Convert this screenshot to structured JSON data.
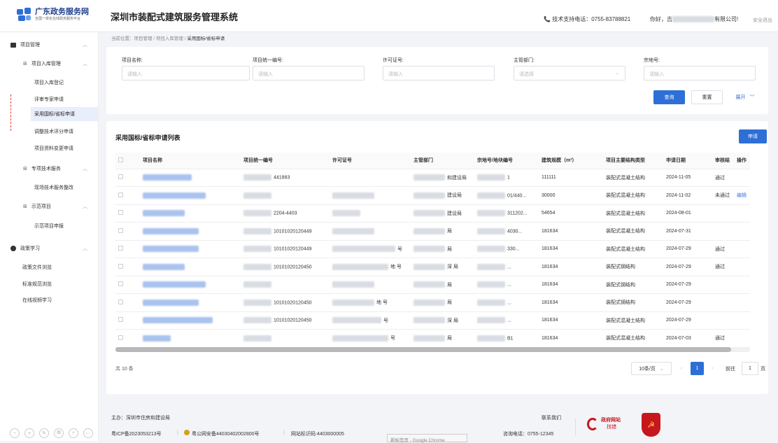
{
  "header": {
    "logo_title": "广东政务服务网",
    "logo_subtitle": "全国一体化在线政务服务平台",
    "system_title": "深圳市装配式建筑服务管理系统",
    "support_phone": "技术支持电话：0755-83788821",
    "greeting_prefix": "你好，吉",
    "greeting_suffix": "有限公司!",
    "logout": "安全退出"
  },
  "sidebar": {
    "project_mgmt": "项目管理",
    "project_storage": "项目入库管理",
    "project_register": "项目入库登记",
    "expert_apply": "评审专家申请",
    "standard_apply": "采用国标/省标申请",
    "score_adjust": "调整技术评分申请",
    "data_change": "项目资料变更申请",
    "tech_service": "专项技术服务",
    "site_service": "现场技术服务整改",
    "demo_project": "示范项目",
    "demo_apply": "示范项目申报",
    "policy": "政策学习",
    "policy_browse": "政策文件浏览",
    "norm_browse": "标准规范浏览",
    "video": "在线视频学习"
  },
  "breadcrumb": {
    "prefix": "当前位置：",
    "path": "项目管理 / 项目入库管理 / ",
    "current": "采用国标/省标申请"
  },
  "filters": {
    "name_label": "项目名称:",
    "name_placeholder": "请输入",
    "code_label": "项目统一编号:",
    "code_placeholder": "请输入",
    "permit_label": "许可证号:",
    "permit_placeholder": "请输入",
    "dept_label": "主管部门:",
    "dept_placeholder": "请选择",
    "land_label": "宗地号:",
    "land_placeholder": "请输入",
    "search_button": "查询",
    "reset_button": "重置",
    "expand_button": "展开"
  },
  "list": {
    "title": "采用国标/省标申请列表",
    "apply_button": "申请",
    "columns": [
      "项目名称",
      "项目统一编号",
      "许可证号",
      "主管部门",
      "宗地号/地块编号",
      "建筑规模（m²）",
      "项目主要结构类型",
      "申请日期",
      "审核结",
      "操作"
    ],
    "rows": [
      {
        "code": "441883",
        "permit": "",
        "dept": "和建设局",
        "land": "1",
        "scale": "111111",
        "type": "装配式混凝土结构",
        "date": "2024-11-05",
        "status": "通过",
        "op": ""
      },
      {
        "code": "",
        "permit": "",
        "dept": "建设局",
        "land": "01/440...",
        "scale": "30000",
        "type": "装配式混凝土结构",
        "date": "2024-11-02",
        "status": "未通过",
        "op": "编辑"
      },
      {
        "code": "2204-4403",
        "permit": "",
        "dept": "建设局",
        "land": "311202...",
        "scale": "54654",
        "type": "装配式混凝土结构",
        "date": "2024-08-01",
        "status": "",
        "op": ""
      },
      {
        "code": "10101020120449",
        "permit": "",
        "dept": "局",
        "land": "4030...",
        "scale": "181634",
        "type": "装配式混凝土结构",
        "date": "2024-07-31",
        "status": "",
        "op": ""
      },
      {
        "code": "10101020120449",
        "permit": "号",
        "dept": "局",
        "land": "330...",
        "scale": "181634",
        "type": "装配式混凝土结构",
        "date": "2024-07-29",
        "status": "通过",
        "op": ""
      },
      {
        "code": "10101020120450",
        "permit": "地 号",
        "dept": "深 局",
        "land": "...",
        "scale": "181634",
        "type": "装配式钢结构",
        "date": "2024-07-29",
        "status": "通过",
        "op": ""
      },
      {
        "code": "",
        "permit": "",
        "dept": "局",
        "land": "...",
        "scale": "181634",
        "type": "装配式钢结构",
        "date": "2024-07-29",
        "status": "",
        "op": ""
      },
      {
        "code": "10101020120450",
        "permit": "地 号",
        "dept": "局",
        "land": "...",
        "scale": "181634",
        "type": "装配式钢结构",
        "date": "2024-07-29",
        "status": "",
        "op": ""
      },
      {
        "code": "10101020120450",
        "permit": "号",
        "dept": "深 局",
        "land": "...",
        "scale": "181634",
        "type": "装配式混凝土结构",
        "date": "2024-07-29",
        "status": "",
        "op": ""
      },
      {
        "code": "",
        "permit": "号",
        "dept": "局",
        "land": "B1",
        "scale": "181634",
        "type": "装配式混凝土结构",
        "date": "2024-07-03",
        "status": "通过",
        "op": ""
      }
    ]
  },
  "pagination": {
    "total": "共 10 条",
    "page_size": "10条/页",
    "current_page": "1",
    "goto_label": "前往",
    "goto_value": "1",
    "page_suffix": "页"
  },
  "footer": {
    "host": "主办：深圳市住房和建设局",
    "icp": "粤ICP备2023053213号",
    "police": "粤公网安备44030402002800号",
    "site_id": "网站标识码:4403000005",
    "browser": "新标签页 - Google Chrome",
    "contact": "联系我们",
    "hotline": "咨询电话：0755-12345",
    "gov_badge": "政府网站",
    "gov_badge2": "找错"
  },
  "colors": {
    "primary": "#2d6fd6",
    "link": "#3a7be0",
    "badge_red": "#c8161d"
  }
}
